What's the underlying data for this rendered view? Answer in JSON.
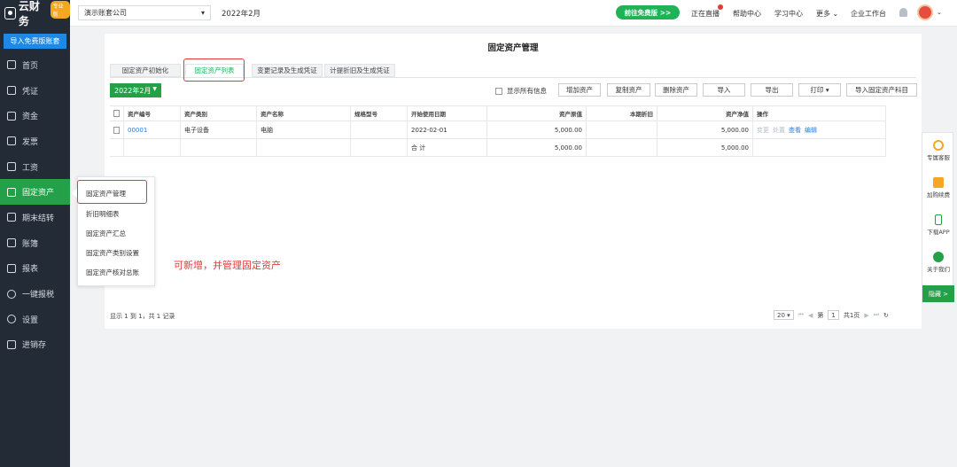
{
  "brand": {
    "name": "云财务",
    "badge": "专业版"
  },
  "sidebar": {
    "import_button": "导入免费版账套",
    "items": [
      {
        "label": "首页",
        "icon": "home-icon"
      },
      {
        "label": "凭证",
        "icon": "voucher-icon"
      },
      {
        "label": "资金",
        "icon": "funds-icon"
      },
      {
        "label": "发票",
        "icon": "invoice-icon"
      },
      {
        "label": "工资",
        "icon": "salary-icon"
      },
      {
        "label": "固定资产",
        "icon": "fixed-asset-icon",
        "active": true
      },
      {
        "label": "期末结转",
        "icon": "period-end-icon"
      },
      {
        "label": "账簿",
        "icon": "ledger-icon"
      },
      {
        "label": "报表",
        "icon": "report-icon"
      },
      {
        "label": "一键报税",
        "icon": "tax-icon"
      },
      {
        "label": "设置",
        "icon": "settings-icon"
      },
      {
        "label": "进销存",
        "icon": "inventory-icon"
      }
    ]
  },
  "topbar": {
    "company": "演示账套公司",
    "period": "2022年2月",
    "upgrade": "前往免费版 >>",
    "links": [
      "正在直播",
      "帮助中心",
      "学习中心",
      "更多",
      "企业工作台"
    ]
  },
  "page": {
    "title": "固定资产管理",
    "tabs": [
      "固定资产初始化",
      "固定资产列表",
      "变更记录及生成凭证",
      "计提折旧及生成凭证"
    ],
    "period_button": "2022年2月",
    "show_all_label": "显示所有信息",
    "toolbar": [
      "增加资产",
      "复制资产",
      "删除资产",
      "导入",
      "导出",
      "打印",
      "导入固定资产科目"
    ]
  },
  "table": {
    "headers": [
      "资产编号",
      "资产类别",
      "资产名称",
      "规格型号",
      "开始使用日期",
      "资产原值",
      "本期折旧",
      "资产净值",
      "操作"
    ],
    "rows": [
      {
        "code": "00001",
        "category": "电子设备",
        "name": "电脑",
        "spec": "",
        "start": "2022-02-01",
        "original": "5,000.00",
        "depreciation": "",
        "net": "5,000.00",
        "ops": [
          "变更",
          "处置",
          "查看",
          "编辑"
        ]
      }
    ],
    "total": {
      "label": "合 计",
      "original": "5,000.00",
      "net": "5,000.00"
    }
  },
  "pager": {
    "info": "显示 1 到 1，共 1 记录",
    "page_size": "20",
    "page_prefix": "第",
    "page": "1",
    "page_suffix": "共1页"
  },
  "flyout": [
    "固定资产管理",
    "折旧明细表",
    "固定资产汇总",
    "固定资产类别设置",
    "固定资产核对总账"
  ],
  "annotation": "可新增，并管理固定资产",
  "float_panel": [
    "专属客服",
    "加购续费",
    "下载APP",
    "关于我们"
  ],
  "hide_button": "隐藏 >",
  "colors": {
    "sidebar_bg": "#222b36",
    "accent_green": "#24a148",
    "highlight_red": "#e53935",
    "link_blue": "#2f7ad8"
  }
}
